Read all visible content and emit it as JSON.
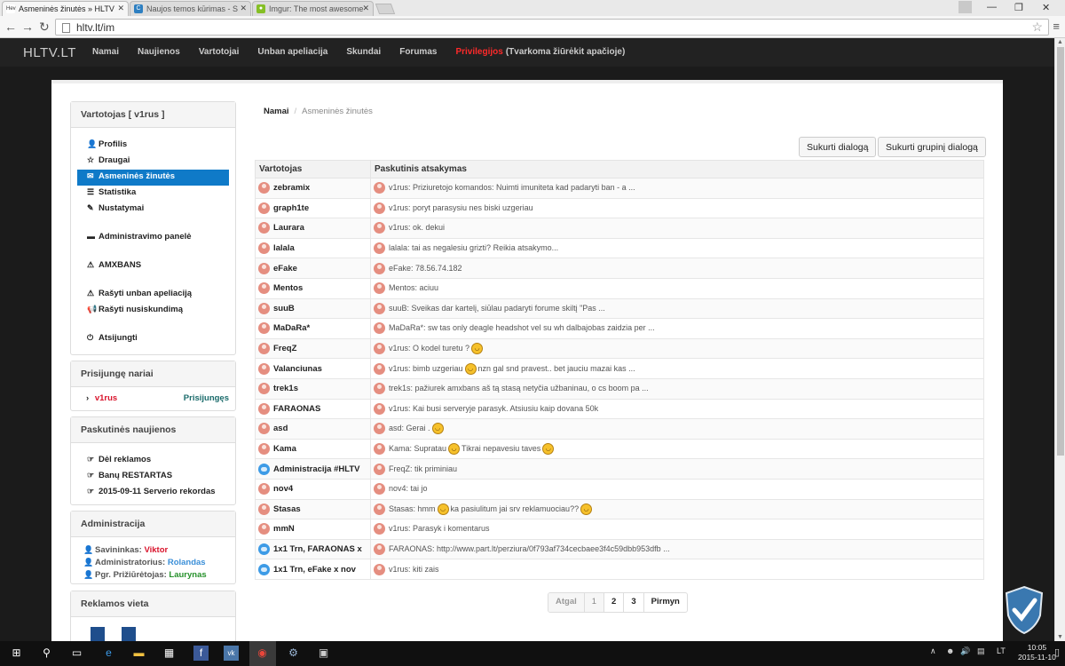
{
  "browser": {
    "tabs": [
      {
        "title": "Asmeninės žinutės » HLTV",
        "favicon": "Hev"
      },
      {
        "title": "Naujos temos kūrimas - S"
      },
      {
        "title": "Imgur: The most awesome"
      }
    ],
    "url": "hltv.lt/im"
  },
  "site": {
    "brand": "HLTV.LT",
    "nav": [
      "Namai",
      "Naujienos",
      "Vartotojai",
      "Unban apeliacija",
      "Skundai",
      "Forumas"
    ],
    "nav_priv": "Privilegijos",
    "nav_priv_note": "(Tvarkoma žiūrėkit apačioje)"
  },
  "sidebar": {
    "user_title": "Vartotojas [ v1rus ]",
    "menu": [
      "Profilis",
      "Draugai",
      "Asmeninės žinutės",
      "Statistika",
      "Nustatymai"
    ],
    "admin_panel": "Administravimo panelė",
    "amxbans": "AMXBANS",
    "unban": "Rašyti unban apeliaciją",
    "complaint": "Rašyti nusiskundimą",
    "logout": "Atsijungti",
    "online_title": "Prisijungę nariai",
    "online_user": "v1rus",
    "online_label": "Prisijungęs",
    "news_title": "Paskutinės naujienos",
    "news": [
      "Dėl reklamos",
      "Banų RESTARTAS",
      "2015-09-11 Serverio rekordas"
    ],
    "admins_title": "Administracija",
    "admins": [
      {
        "role": "Savininkas:",
        "name": "Viktor",
        "color": "#d9142c"
      },
      {
        "role": "Administratorius:",
        "name": "Rolandas",
        "color": "#3b8fd8"
      },
      {
        "role": "Pgr. Prižiūrėtojas:",
        "name": "Laurynas",
        "color": "#26912b"
      }
    ],
    "ads_title": "Reklamos vieta"
  },
  "breadcrumb": {
    "home": "Namai",
    "current": "Asmeninės žinutės"
  },
  "buttons": {
    "create_dialog": "Sukurti dialogą",
    "create_group": "Sukurti grupinį dialogą"
  },
  "table": {
    "headers": [
      "Vartotojas",
      "Paskutinis atsakymas"
    ],
    "rows": [
      {
        "user": "zebramix",
        "parts": [
          "v1rus: Priziuretojo komandos: Nuimti imuniteta kad padaryti ban - a ..."
        ]
      },
      {
        "user": "graph1te",
        "parts": [
          "v1rus: poryt parasysiu nes biski uzgeriau"
        ]
      },
      {
        "user": "Laurara",
        "parts": [
          "v1rus: ok. dekui"
        ]
      },
      {
        "user": "lalala",
        "parts": [
          "lalala: tai as negalesiu grizti? Reikia atsakymo..."
        ]
      },
      {
        "user": "eFake",
        "parts": [
          "eFake: 78.56.74.182"
        ]
      },
      {
        "user": "Mentos",
        "parts": [
          "Mentos: aciuu"
        ]
      },
      {
        "user": "suuB",
        "parts": [
          "suuB: Sveikas dar kartelį, siūlau padaryti forume skiltį \"Pas ..."
        ]
      },
      {
        "user": "MaDaRa*",
        "parts": [
          "MaDaRa*: sw tas only deagle headshot vel su wh dalbajobas zaidzia per ..."
        ]
      },
      {
        "user": "FreqZ",
        "parts": [
          "v1rus: O kodel turetu ?"
        ],
        "smile_after": [
          0
        ]
      },
      {
        "user": "Valanciunas",
        "parts": [
          "v1rus: bimb uzgeriau",
          "nzn gal snd pravest.. bet jauciu mazai kas ..."
        ],
        "smile_after": [
          0
        ]
      },
      {
        "user": "trek1s",
        "parts": [
          "trek1s: pažiurek amxbans aš tą stasą netyčia užbaninau, o cs boom pa ..."
        ]
      },
      {
        "user": "FARAONAS",
        "parts": [
          "v1rus: Kai busi serveryje parasyk. Atsiusiu kaip dovana 50k"
        ]
      },
      {
        "user": "asd",
        "parts": [
          "asd: Gerai ."
        ],
        "smile_after": [
          0
        ]
      },
      {
        "user": "Kama",
        "parts": [
          "Kama: Supratau",
          "Tikrai nepavesiu taves"
        ],
        "smile_after": [
          0,
          1
        ]
      },
      {
        "user": "Administracija #HLTV",
        "group": true,
        "parts": [
          "FreqZ: tik priminiau"
        ]
      },
      {
        "user": "nov4",
        "parts": [
          "nov4: tai jo"
        ]
      },
      {
        "user": "Stasas",
        "parts": [
          "Stasas: hmm",
          "ka pasiulitum jai srv reklamuociau??"
        ],
        "smile_after": [
          0,
          1
        ]
      },
      {
        "user": "mmN",
        "parts": [
          "v1rus: Parasyk i komentarus"
        ]
      },
      {
        "user": "1x1 Trn, FARAONAS x",
        "group": true,
        "parts": [
          "FARAONAS: http://www.part.lt/perziura/0f793af734cecbaee3f4c59dbb953dfb ..."
        ]
      },
      {
        "user": "1x1 Trn, eFake x nov",
        "group": true,
        "parts": [
          "v1rus: kiti zais"
        ]
      }
    ]
  },
  "pager": [
    "Atgal",
    "1",
    "2",
    "3",
    "Pirmyn"
  ],
  "taskbar": {
    "lang": "LT",
    "time": "10:05",
    "date": "2015-11-10"
  }
}
